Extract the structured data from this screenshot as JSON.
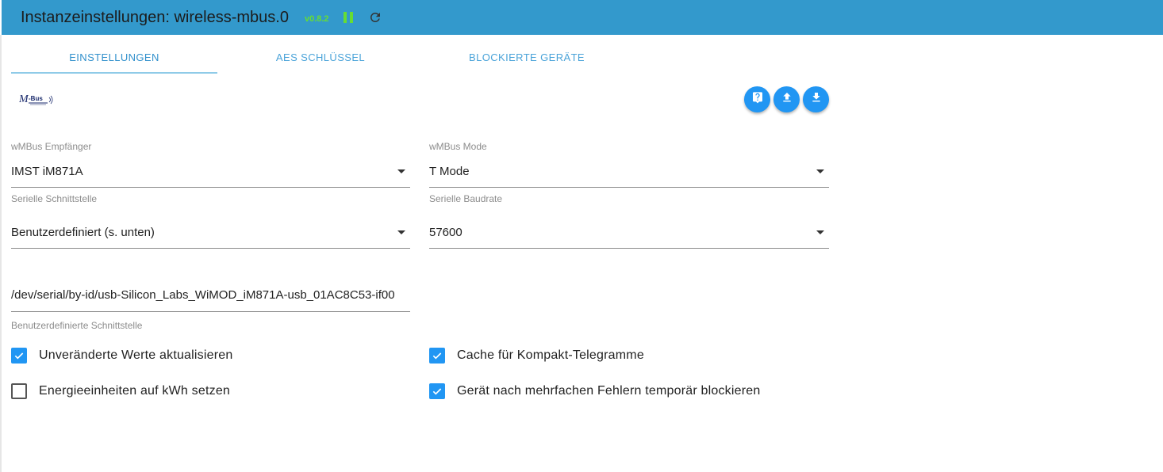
{
  "header": {
    "title": "Instanzeinstellungen: wireless-mbus.0",
    "version": "v0.8.2",
    "pause_icon": "pause-icon",
    "reload_icon": "reload-icon",
    "bar_color": "#3399cc",
    "version_color": "#66dd33"
  },
  "tabs": [
    {
      "label": "EINSTELLUNGEN",
      "active": true
    },
    {
      "label": "AES SCHLÜSSEL",
      "active": false
    },
    {
      "label": "BLOCKIERTE GERÄTE",
      "active": false
    }
  ],
  "logo": {
    "text": "M-Bus"
  },
  "actions": [
    {
      "icon": "help-icon"
    },
    {
      "icon": "upload-icon"
    },
    {
      "icon": "download-icon"
    }
  ],
  "form": {
    "receiver": {
      "label": "wMBus Empfänger",
      "value": "IMST iM871A"
    },
    "mode": {
      "label": "wMBus Mode",
      "value": "T Mode"
    },
    "serial_port": {
      "label": "Serielle Schnittstelle",
      "value": "Benutzerdefiniert (s. unten)"
    },
    "baudrate": {
      "label": "Serielle Baudrate",
      "value": "57600"
    },
    "custom_port": {
      "value": "/dev/serial/by-id/usb-Silicon_Labs_WiMOD_iM871A-usb_01AC8C53-if00",
      "label": "Benutzerdefinierte Schnittstelle"
    }
  },
  "checkboxes": {
    "update_unchanged": {
      "label": "Unveränderte Werte aktualisieren",
      "checked": true
    },
    "energy_kwh": {
      "label": "Energieeinheiten auf kWh setzen",
      "checked": false
    },
    "cache_compact": {
      "label": "Cache für Kompakt-Telegramme",
      "checked": true
    },
    "block_devices": {
      "label": "Gerät nach mehrfachen Fehlern temporär blockieren",
      "checked": true
    }
  },
  "colors": {
    "accent": "#2196f3",
    "tab_text": "#4aa3d9"
  }
}
